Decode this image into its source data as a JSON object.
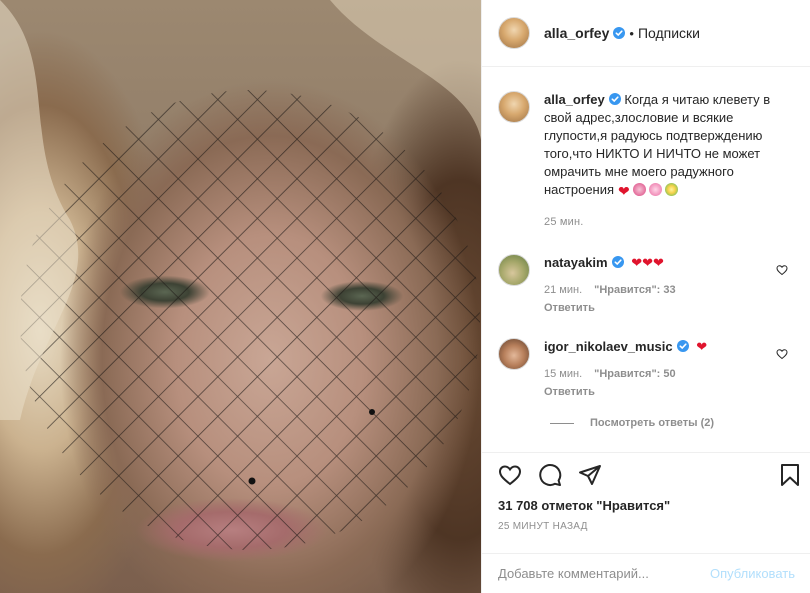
{
  "post": {
    "username": "alla_orfey",
    "follow_label": "Подписки",
    "dot": "•",
    "caption": "Когда я читаю клевету в свой адрес,злословие и всякие глупости,я радуюсь подтверждению того,что НИКТО И НИЧТО не может омрачить мне моего радужного настроения",
    "caption_time": "25 мин."
  },
  "comments": [
    {
      "username": "natayakim",
      "text": "❤❤❤",
      "time": "21 мин.",
      "likes": "\"Нравится\": 33",
      "reply": "Ответить"
    },
    {
      "username": "igor_nikolaev_music",
      "text": "❤",
      "time": "15 мин.",
      "likes": "\"Нравится\": 50",
      "reply": "Ответить"
    }
  ],
  "view_replies": "Посмотреть ответы (2)",
  "likes_count": "31 708 отметок \"Нравится\"",
  "posted_ago": "25 МИНУТ НАЗАД",
  "comment_input": {
    "placeholder": "Добавьте комментарий...",
    "publish_label": "Опубликовать"
  },
  "colors": {
    "verified": "#3897f0",
    "heart": "#e0142d",
    "muted": "#8e8e8e",
    "publish_disabled": "#b2dffc"
  },
  "icons": [
    "verified-badge-icon",
    "heart-icon",
    "comment-icon",
    "share-icon",
    "bookmark-icon"
  ]
}
